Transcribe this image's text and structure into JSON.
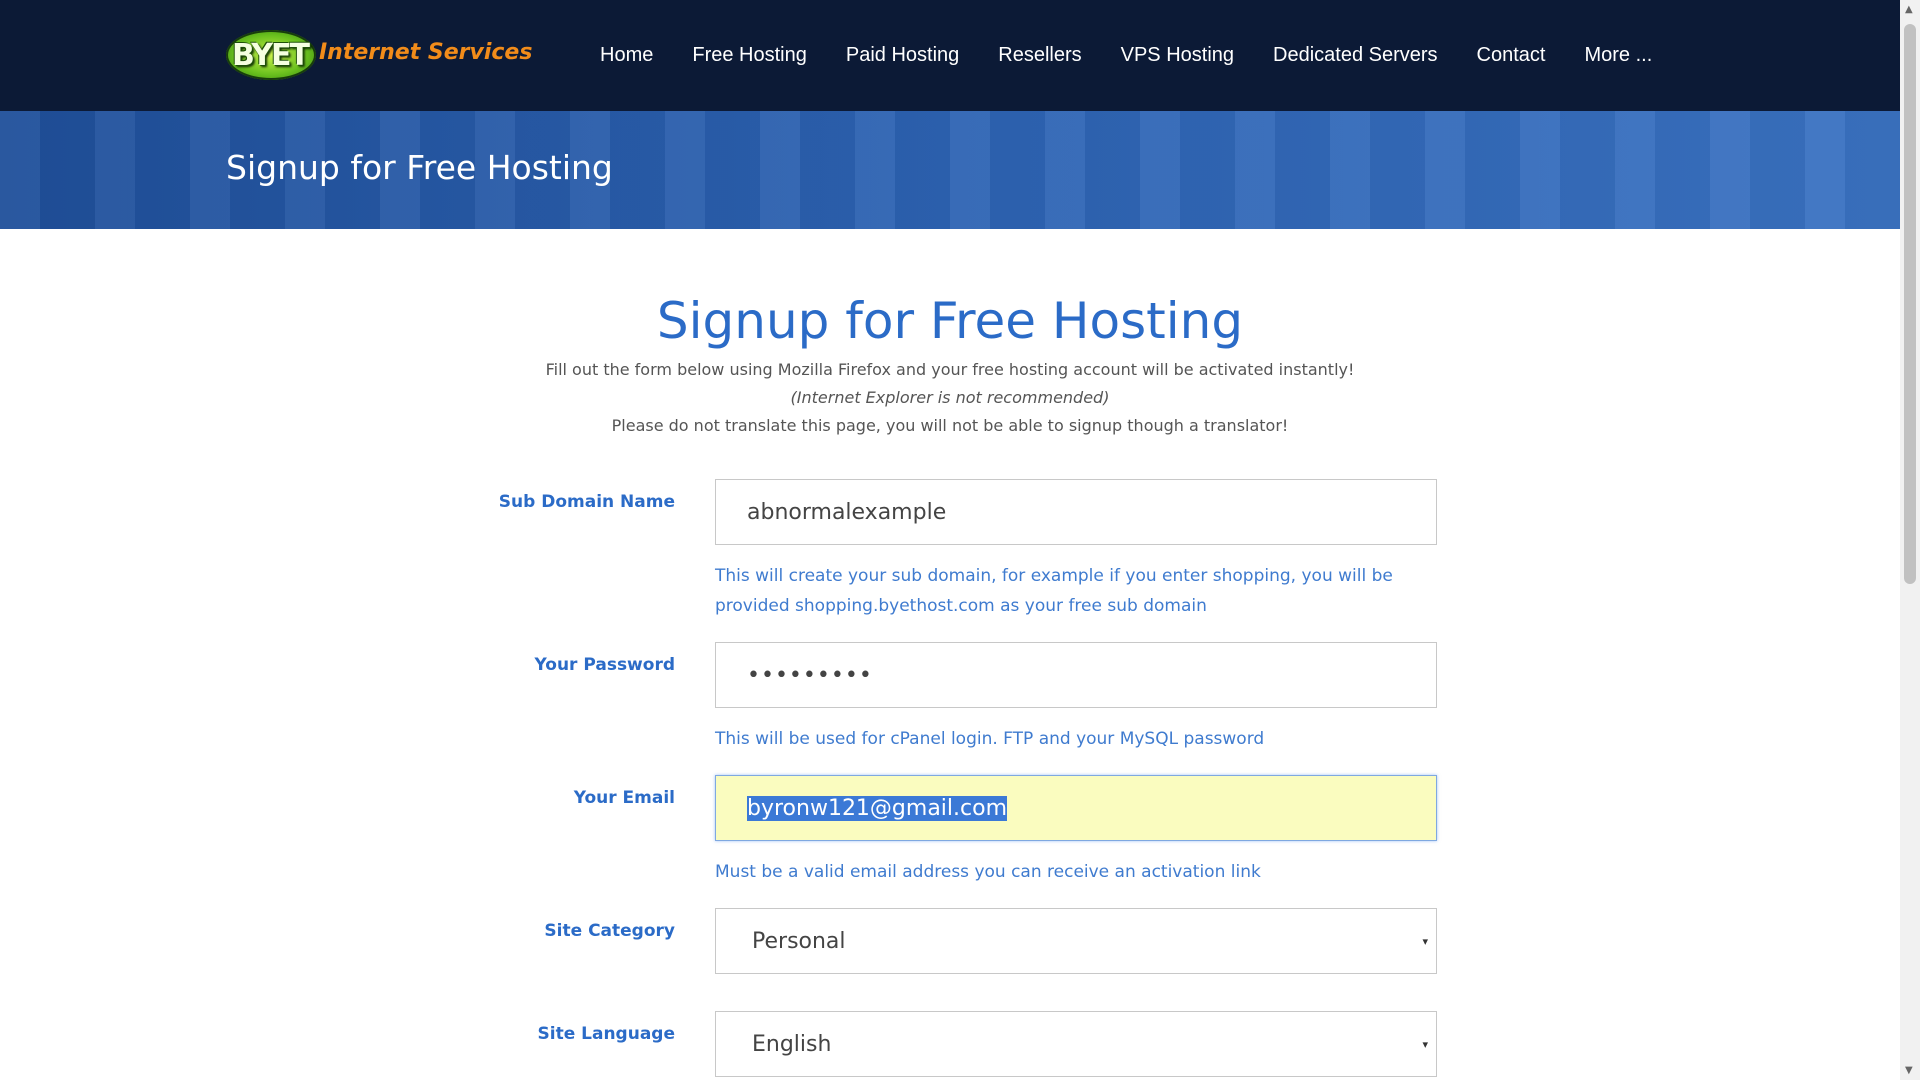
{
  "header": {
    "logo_badge": "BYET",
    "logo_brand": "Internet Services",
    "nav": [
      "Home",
      "Free Hosting",
      "Paid Hosting",
      "Resellers",
      "VPS Hosting",
      "Dedicated Servers",
      "Contact",
      "More ..."
    ]
  },
  "banner": {
    "title": "Signup for Free Hosting"
  },
  "form_intro": {
    "title": "Signup for Free Hosting",
    "line1": "Fill out the form below using Mozilla Firefox and your free hosting account will be activated instantly!",
    "line2": "(Internet Explorer is not recommended)",
    "line3": "Please do not translate this page, you will not be able to signup though a translator!"
  },
  "form": {
    "subdomain": {
      "label": "Sub Domain Name",
      "value": "abnormalexample",
      "help_1": "This will create your sub domain, for example if you enter shopping, you will be",
      "help_2": "provided shopping.byethost.com as your free sub domain"
    },
    "password": {
      "label": "Your Password",
      "value": "•••••••••",
      "help": "This will be used for cPanel login. FTP and your MySQL password"
    },
    "email": {
      "label": "Your Email",
      "value": "byronw121@gmail.com",
      "help": "Must be a valid email address you can receive an activation link"
    },
    "category": {
      "label": "Site Category",
      "value": "Personal"
    },
    "language": {
      "label": "Site Language",
      "value": "English"
    }
  },
  "colors": {
    "header_bg": "#0c1a36",
    "accent": "#2b6bc7",
    "email_highlight": "#fafcbf",
    "brand_orange": "#f28c1a",
    "logo_green": "#6ac01e"
  },
  "icons": {
    "select_caret": "▾",
    "scroll_up": "▲",
    "scroll_down": "▼"
  }
}
